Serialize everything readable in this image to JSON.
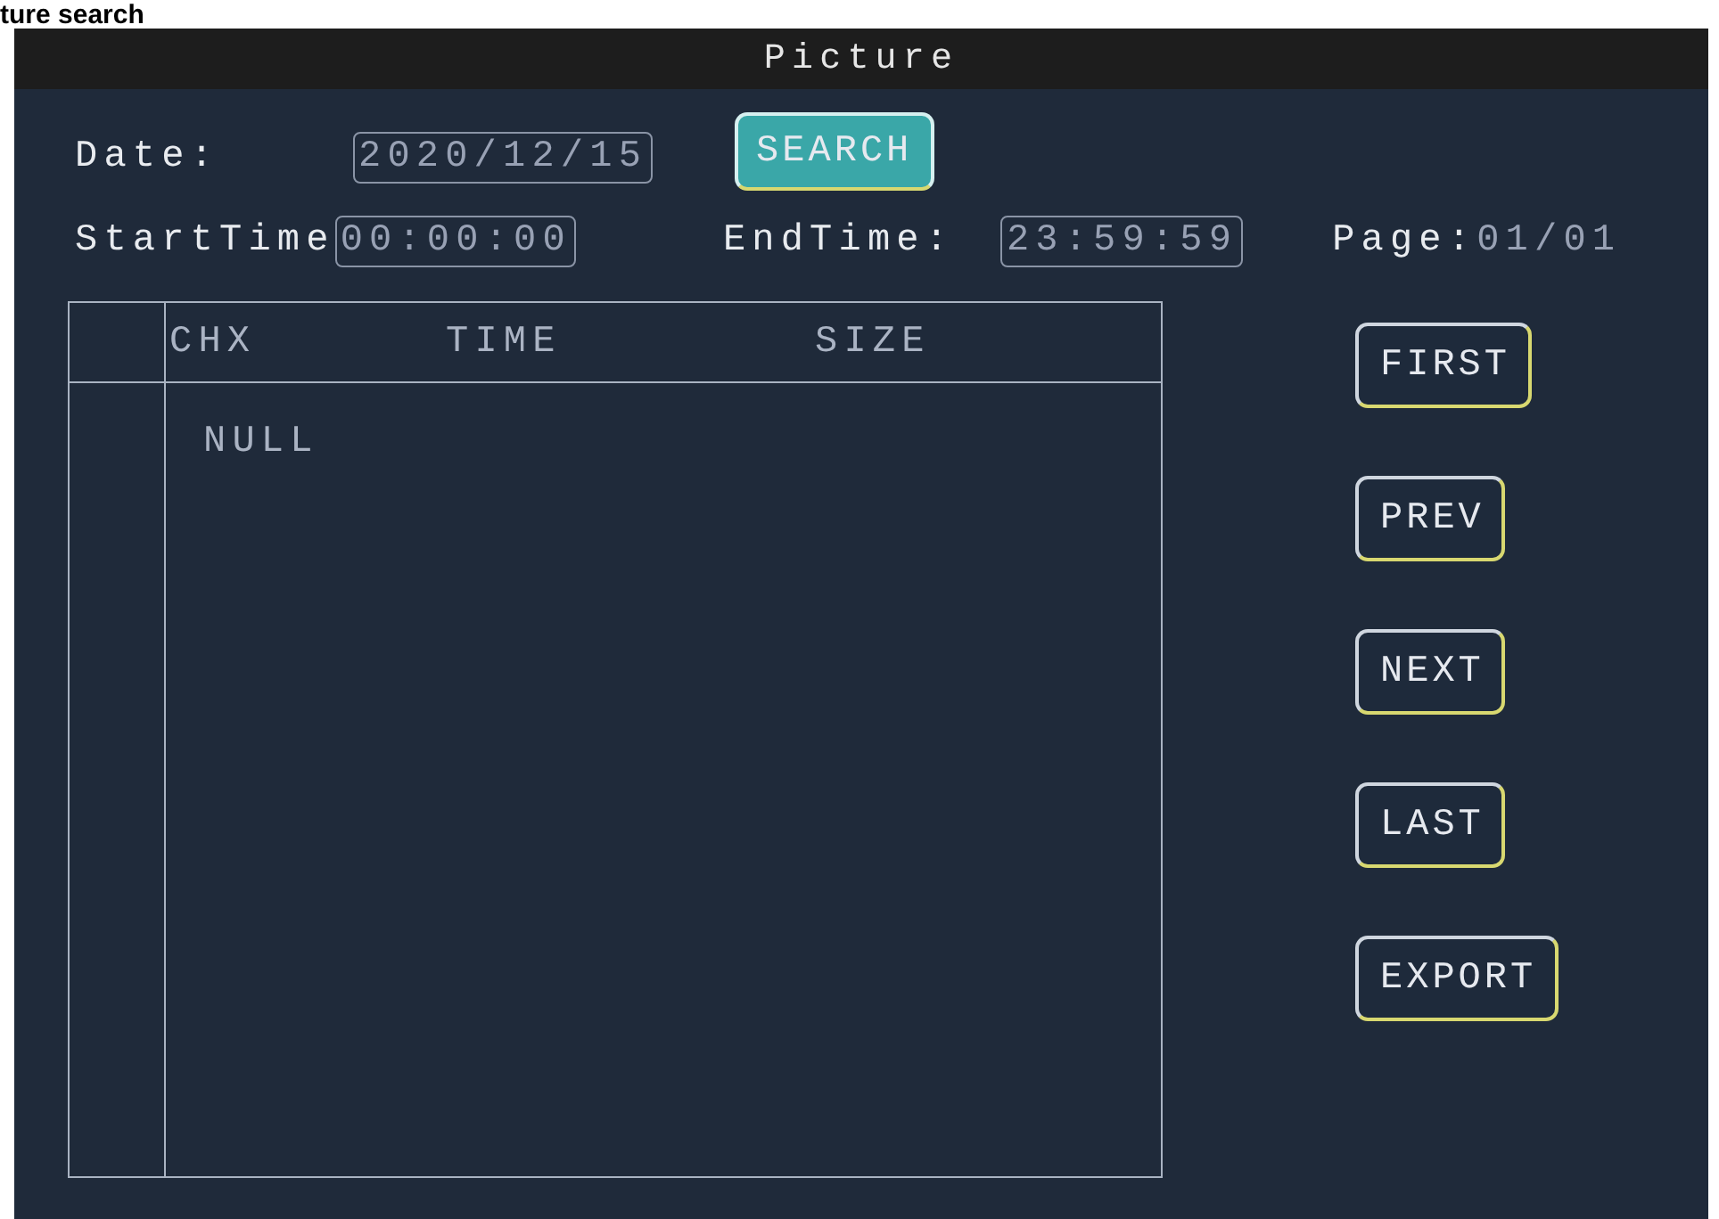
{
  "caption": "ture search",
  "window": {
    "title": "Picture"
  },
  "search_form": {
    "date_label": "Date:",
    "date": "2020/12/15",
    "search_button": {
      "label": "SEARCH",
      "focused": true
    },
    "start_label": "StartTime",
    "start_time": "00:00:00",
    "end_label": "EndTime:",
    "end_time": "23:59:59",
    "page_label": "Page:",
    "page": "01/01"
  },
  "table": {
    "columns": [
      "CHX",
      "TIME",
      "SIZE"
    ],
    "empty_text": "NULL"
  },
  "buttons": [
    "FIRST",
    "PREV",
    "NEXT",
    "LAST",
    "EXPORT"
  ]
}
